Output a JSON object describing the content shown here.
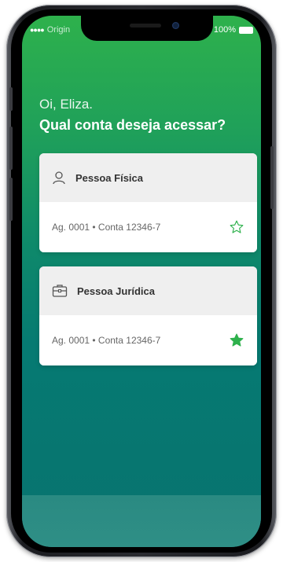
{
  "status_bar": {
    "signal": "●●●●",
    "carrier": "Origin",
    "battery": "100%"
  },
  "greeting": "Oi, Eliza.",
  "question": "Qual conta deseja acessar?",
  "accounts": [
    {
      "type_label": "Pessoa Física",
      "icon": "person-icon",
      "info": "Ag. 0001 • Conta 12346-7",
      "favorite": false
    },
    {
      "type_label": "Pessoa Jurídica",
      "icon": "briefcase-icon",
      "info": "Ag. 0001 • Conta 12346-7",
      "favorite": true
    }
  ],
  "colors": {
    "brand_green": "#2eb14c",
    "teal": "#067a72",
    "star_green": "#2eb14c"
  }
}
